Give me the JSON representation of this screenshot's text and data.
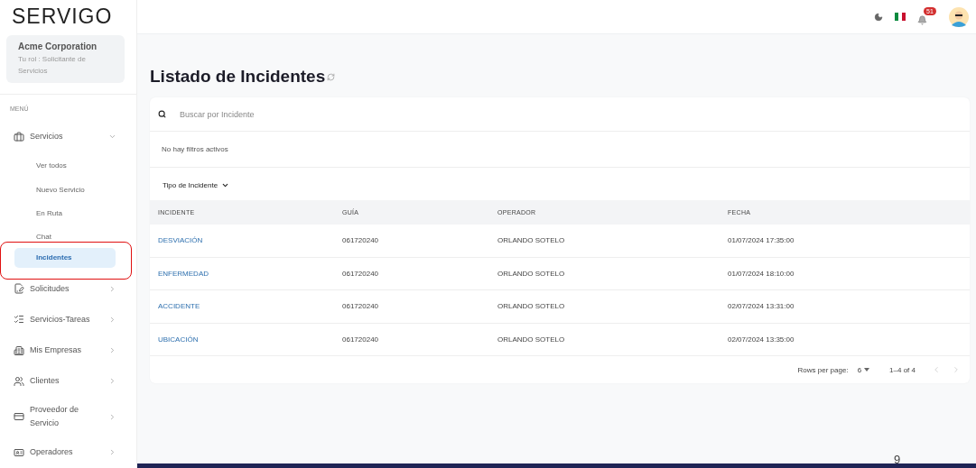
{
  "logo": {
    "text": "SERVIGO"
  },
  "org_card": {
    "name": "Acme Corporation",
    "role": "Tu rol : Solicitante de Servicios"
  },
  "menu_label": "MENÚ",
  "sidebar": {
    "items": [
      {
        "label": "Servicios",
        "expanded": true,
        "children": [
          {
            "label": "Ver todos",
            "selected": false
          },
          {
            "label": "Nuevo Servicio",
            "selected": false
          },
          {
            "label": "En Ruta",
            "selected": false
          },
          {
            "label": "Chat",
            "selected": false
          },
          {
            "label": "Incidentes",
            "selected": true
          }
        ]
      },
      {
        "label": "Solicitudes",
        "expanded": false
      },
      {
        "label": "Servicios-Tareas",
        "expanded": false
      },
      {
        "label": "Mis Empresas",
        "expanded": false
      },
      {
        "label": "Clientes",
        "expanded": false
      },
      {
        "label": "Proveedor de Servicio",
        "expanded": false
      },
      {
        "label": "Operadores",
        "expanded": false
      }
    ]
  },
  "header": {
    "notification_count": "51"
  },
  "page_title": "Listado de Incidentes",
  "search": {
    "placeholder": "Buscar por Incidente"
  },
  "filters_note": "No hay filtros activos",
  "filter_dropdown": "Tipo de Incidente",
  "table": {
    "columns": [
      "INCIDENTE",
      "GUÍA",
      "OPERADOR",
      "FECHA"
    ],
    "rows": [
      [
        "DESVIACIÓN",
        "061720240",
        "ORLANDO SOTELO",
        "01/07/2024 17:35:00"
      ],
      [
        "ENFERMEDAD",
        "061720240",
        "ORLANDO SOTELO",
        "01/07/2024 18:10:00"
      ],
      [
        "ACCIDENTE",
        "061720240",
        "ORLANDO SOTELO",
        "02/07/2024 13:31:00"
      ],
      [
        "UBICACIÓN",
        "061720240",
        "ORLANDO SOTELO",
        "02/07/2024 13:35:00"
      ]
    ]
  },
  "pagination": {
    "rows_per_page_label": "Rows per page:",
    "rows_per_page": "6",
    "range": "1–4 of 4"
  },
  "slide_page_number": "9"
}
